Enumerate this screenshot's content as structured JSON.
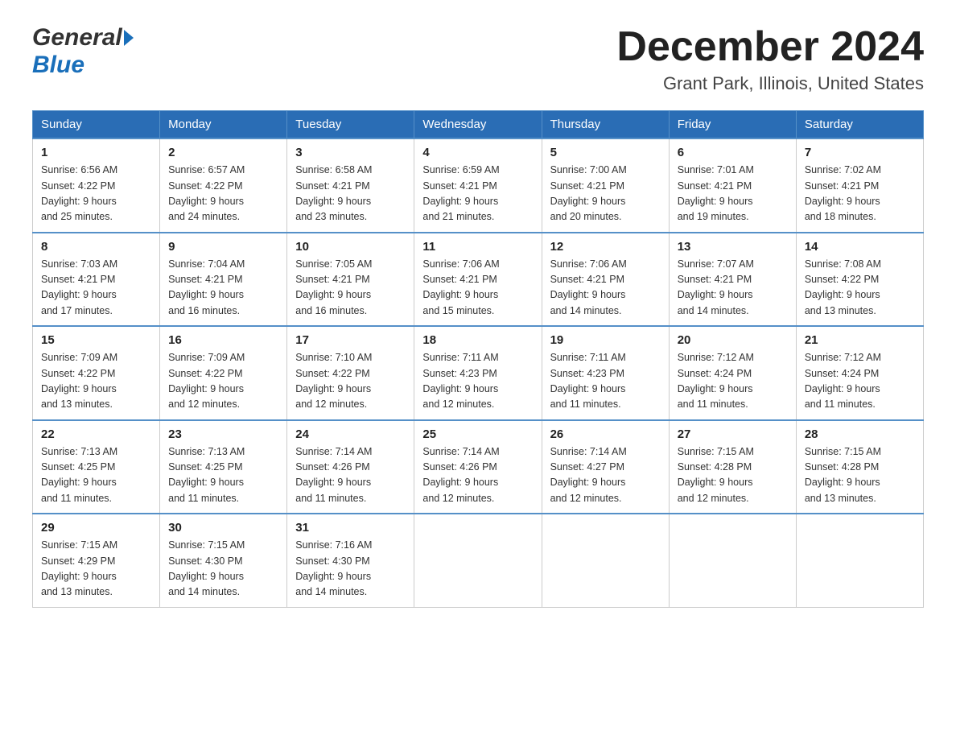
{
  "header": {
    "logo_general": "General",
    "logo_blue": "Blue",
    "month_title": "December 2024",
    "location": "Grant Park, Illinois, United States"
  },
  "days_of_week": [
    "Sunday",
    "Monday",
    "Tuesday",
    "Wednesday",
    "Thursday",
    "Friday",
    "Saturday"
  ],
  "weeks": [
    [
      {
        "day": "1",
        "sunrise": "6:56 AM",
        "sunset": "4:22 PM",
        "daylight": "9 hours and 25 minutes."
      },
      {
        "day": "2",
        "sunrise": "6:57 AM",
        "sunset": "4:22 PM",
        "daylight": "9 hours and 24 minutes."
      },
      {
        "day": "3",
        "sunrise": "6:58 AM",
        "sunset": "4:21 PM",
        "daylight": "9 hours and 23 minutes."
      },
      {
        "day": "4",
        "sunrise": "6:59 AM",
        "sunset": "4:21 PM",
        "daylight": "9 hours and 21 minutes."
      },
      {
        "day": "5",
        "sunrise": "7:00 AM",
        "sunset": "4:21 PM",
        "daylight": "9 hours and 20 minutes."
      },
      {
        "day": "6",
        "sunrise": "7:01 AM",
        "sunset": "4:21 PM",
        "daylight": "9 hours and 19 minutes."
      },
      {
        "day": "7",
        "sunrise": "7:02 AM",
        "sunset": "4:21 PM",
        "daylight": "9 hours and 18 minutes."
      }
    ],
    [
      {
        "day": "8",
        "sunrise": "7:03 AM",
        "sunset": "4:21 PM",
        "daylight": "9 hours and 17 minutes."
      },
      {
        "day": "9",
        "sunrise": "7:04 AM",
        "sunset": "4:21 PM",
        "daylight": "9 hours and 16 minutes."
      },
      {
        "day": "10",
        "sunrise": "7:05 AM",
        "sunset": "4:21 PM",
        "daylight": "9 hours and 16 minutes."
      },
      {
        "day": "11",
        "sunrise": "7:06 AM",
        "sunset": "4:21 PM",
        "daylight": "9 hours and 15 minutes."
      },
      {
        "day": "12",
        "sunrise": "7:06 AM",
        "sunset": "4:21 PM",
        "daylight": "9 hours and 14 minutes."
      },
      {
        "day": "13",
        "sunrise": "7:07 AM",
        "sunset": "4:21 PM",
        "daylight": "9 hours and 14 minutes."
      },
      {
        "day": "14",
        "sunrise": "7:08 AM",
        "sunset": "4:22 PM",
        "daylight": "9 hours and 13 minutes."
      }
    ],
    [
      {
        "day": "15",
        "sunrise": "7:09 AM",
        "sunset": "4:22 PM",
        "daylight": "9 hours and 13 minutes."
      },
      {
        "day": "16",
        "sunrise": "7:09 AM",
        "sunset": "4:22 PM",
        "daylight": "9 hours and 12 minutes."
      },
      {
        "day": "17",
        "sunrise": "7:10 AM",
        "sunset": "4:22 PM",
        "daylight": "9 hours and 12 minutes."
      },
      {
        "day": "18",
        "sunrise": "7:11 AM",
        "sunset": "4:23 PM",
        "daylight": "9 hours and 12 minutes."
      },
      {
        "day": "19",
        "sunrise": "7:11 AM",
        "sunset": "4:23 PM",
        "daylight": "9 hours and 11 minutes."
      },
      {
        "day": "20",
        "sunrise": "7:12 AM",
        "sunset": "4:24 PM",
        "daylight": "9 hours and 11 minutes."
      },
      {
        "day": "21",
        "sunrise": "7:12 AM",
        "sunset": "4:24 PM",
        "daylight": "9 hours and 11 minutes."
      }
    ],
    [
      {
        "day": "22",
        "sunrise": "7:13 AM",
        "sunset": "4:25 PM",
        "daylight": "9 hours and 11 minutes."
      },
      {
        "day": "23",
        "sunrise": "7:13 AM",
        "sunset": "4:25 PM",
        "daylight": "9 hours and 11 minutes."
      },
      {
        "day": "24",
        "sunrise": "7:14 AM",
        "sunset": "4:26 PM",
        "daylight": "9 hours and 11 minutes."
      },
      {
        "day": "25",
        "sunrise": "7:14 AM",
        "sunset": "4:26 PM",
        "daylight": "9 hours and 12 minutes."
      },
      {
        "day": "26",
        "sunrise": "7:14 AM",
        "sunset": "4:27 PM",
        "daylight": "9 hours and 12 minutes."
      },
      {
        "day": "27",
        "sunrise": "7:15 AM",
        "sunset": "4:28 PM",
        "daylight": "9 hours and 12 minutes."
      },
      {
        "day": "28",
        "sunrise": "7:15 AM",
        "sunset": "4:28 PM",
        "daylight": "9 hours and 13 minutes."
      }
    ],
    [
      {
        "day": "29",
        "sunrise": "7:15 AM",
        "sunset": "4:29 PM",
        "daylight": "9 hours and 13 minutes."
      },
      {
        "day": "30",
        "sunrise": "7:15 AM",
        "sunset": "4:30 PM",
        "daylight": "9 hours and 14 minutes."
      },
      {
        "day": "31",
        "sunrise": "7:16 AM",
        "sunset": "4:30 PM",
        "daylight": "9 hours and 14 minutes."
      },
      null,
      null,
      null,
      null
    ]
  ],
  "labels": {
    "sunrise": "Sunrise:",
    "sunset": "Sunset:",
    "daylight": "Daylight:"
  }
}
